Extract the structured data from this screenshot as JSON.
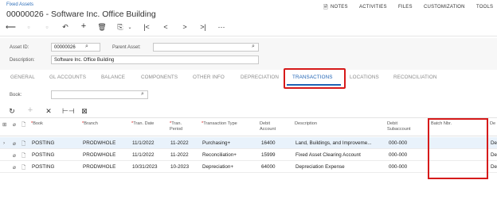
{
  "header": {
    "breadcrumb": "Fixed Assets",
    "title": "00000026 - Software Inc. Office Building",
    "menu": [
      "NOTES",
      "ACTIVITIES",
      "FILES",
      "CUSTOMIZATION",
      "TOOLS"
    ]
  },
  "toolbar": {
    "icons": [
      "undo-icon",
      "save-icon",
      "save-close-icon",
      "cancel-icon",
      "add-icon",
      "delete-icon",
      "copy-paste-icon",
      "first-icon",
      "previous-icon",
      "next-icon",
      "last-icon",
      "more-icon"
    ]
  },
  "form": {
    "asset_id_label": "Asset ID:",
    "asset_id_value": "00000026",
    "parent_asset_label": "Parent Asset:",
    "parent_asset_value": "",
    "description_label": "Description:",
    "description_value": "Software Inc. Office Building"
  },
  "tabs": [
    "GENERAL",
    "GL ACCOUNTS",
    "BALANCE",
    "COMPONENTS",
    "OTHER INFO",
    "DEPRECIATION",
    "TRANSACTIONS",
    "LOCATIONS",
    "RECONCILIATION"
  ],
  "active_tab": "TRANSACTIONS",
  "filter": {
    "book_label": "Book:",
    "book_value": ""
  },
  "grid": {
    "columns": {
      "book": "Book",
      "branch": "Branch",
      "tran_date": "Tran. Date",
      "tran_period_1": "Tran.",
      "tran_period_2": "Period",
      "tran_type": "Transaction Type",
      "debit_account_1": "Debit",
      "debit_account_2": "Account",
      "description": "Description",
      "debit_sub_1": "Debit",
      "debit_sub_2": "Subaccount",
      "batch": "Batch Nbr.",
      "extra": "De"
    },
    "rows": [
      {
        "book": "POSTING",
        "branch": "PRODWHOLE",
        "date": "11/1/2022",
        "period": "11-2022",
        "type": "Purchasing+",
        "account": "16400",
        "description": "Land, Buildings, and Improveme...",
        "sub": "000-000",
        "batch": "",
        "extra": "De"
      },
      {
        "book": "POSTING",
        "branch": "PRODWHOLE",
        "date": "11/1/2022",
        "period": "11-2022",
        "type": "Reconciliation+",
        "account": "15999",
        "description": "Fixed Asset Clearing Account",
        "sub": "000-000",
        "batch": "",
        "extra": "De"
      },
      {
        "book": "POSTING",
        "branch": "PRODWHOLE",
        "date": "10/31/2023",
        "period": "10-2023",
        "type": "Depreciation+",
        "account": "64000",
        "description": "Depreciation Expense",
        "sub": "000-000",
        "batch": "",
        "extra": "De"
      }
    ]
  },
  "colors": {
    "accent": "#1f63b4",
    "highlight": "#d61a1a",
    "selected_row": "#e9f2fb"
  }
}
